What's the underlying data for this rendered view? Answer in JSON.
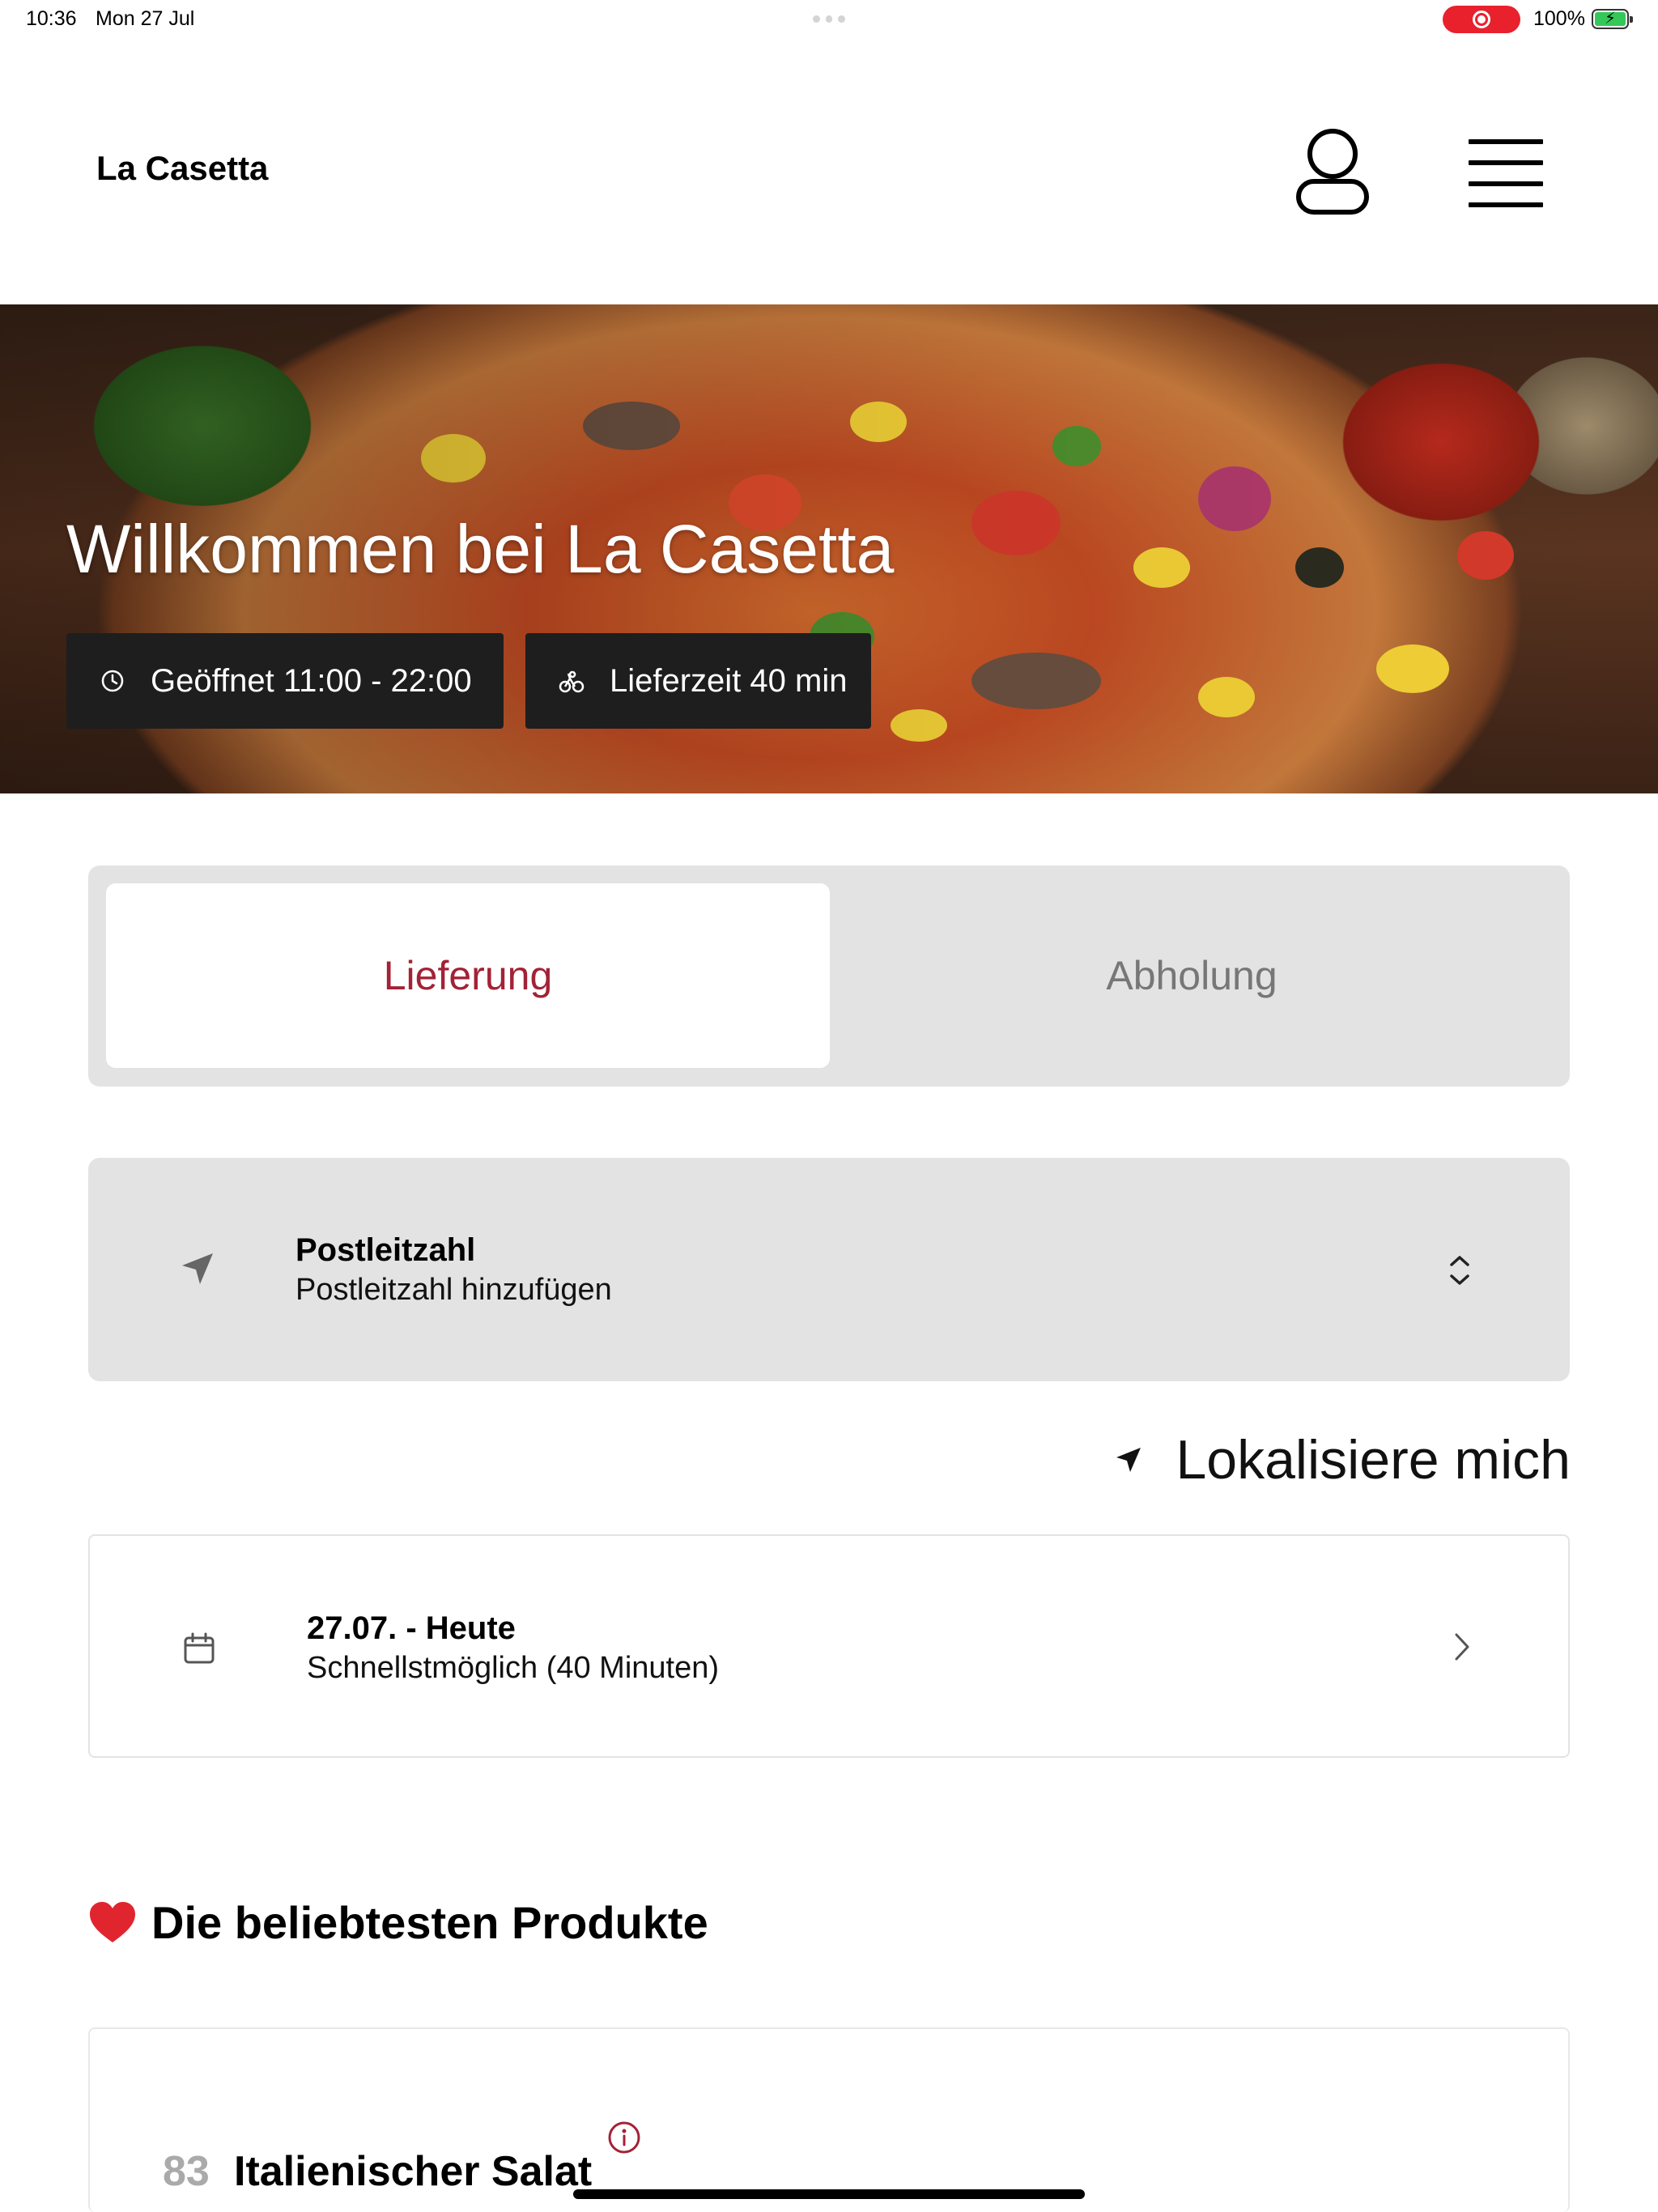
{
  "status_bar": {
    "time": "10:36",
    "date": "Mon 27 Jul",
    "battery": "100%",
    "recording_color": "#e8212c",
    "battery_color": "#34c759"
  },
  "header": {
    "brand": "La Casetta",
    "profile_icon": "person-icon",
    "menu_icon": "hamburger-menu-icon"
  },
  "hero": {
    "title": "Willkommen bei La Casetta",
    "opening_hours": "Geöffnet 11:00 - 22:00",
    "delivery_time": "Lieferzeit 40 min",
    "opening_icon": "clock-icon",
    "delivery_icon": "bicycle-icon"
  },
  "order_mode": {
    "tabs": [
      {
        "label": "Lieferung",
        "active": true
      },
      {
        "label": "Abholung",
        "active": false
      }
    ],
    "active_color": "#a32236"
  },
  "postcode": {
    "label": "Postleitzahl",
    "value": "Postleitzahl hinzufügen",
    "icon": "location-arrow-icon",
    "control_icon": "chevron-up-down-icon"
  },
  "locate": {
    "label": "Lokalisiere mich",
    "icon": "location-arrow-icon"
  },
  "date_select": {
    "label": "27.07. - Heute",
    "value": "Schnellstmöglich (40 Minuten)",
    "icon": "calendar-icon",
    "chevron": "chevron-right-icon"
  },
  "popular": {
    "title": "Die beliebtesten Produkte",
    "icon": "heart-icon",
    "products": [
      {
        "number": "83",
        "name": "Italienischer Salat"
      }
    ]
  }
}
